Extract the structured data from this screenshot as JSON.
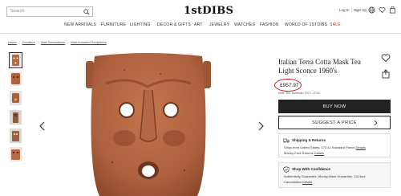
{
  "search": {
    "placeholder": "Search"
  },
  "logo": {
    "text": "1stDIBS"
  },
  "header": {
    "login": "Log In",
    "separator": "|",
    "signup": "Sign Up"
  },
  "nav": [
    {
      "label": "NEW ARRIVALS"
    },
    {
      "label": "FURNITURE"
    },
    {
      "label": "LIGHTING"
    },
    {
      "label": "DECOR & GIFTS"
    },
    {
      "label": "ART"
    },
    {
      "label": "JEWELRY"
    },
    {
      "label": "WATCHES"
    },
    {
      "label": "FASHION"
    },
    {
      "label": "WORLD OF 1STDIBS"
    },
    {
      "label": "SALE"
    }
  ],
  "breadcrumb": [
    "Home",
    "Furniture",
    "Wall Decorations",
    "Wall-mounted Sculptures"
  ],
  "product": {
    "title": "Italian Terra Cotta Mask Tea Light Sconce 1960's",
    "price": "£957.97",
    "estimate": "Note: Est. Estimate: £372 - £744"
  },
  "actions": {
    "buy": "BUY NOW",
    "suggest": "SUGGEST A PRICE"
  },
  "shipping": {
    "title": "Shipping & Returns",
    "line1_text": "Ships from United States: £73.42 Standard Parcel",
    "line1_link": "Details",
    "line2_text": "Money-Free Returns",
    "line2_link": "Details"
  },
  "confidence": {
    "title": "Shop With Confidence",
    "line1": "Authenticity Guarantee, Money-Back Guarantee, 24-Hour",
    "line2_text": "Cancellation",
    "line2_link": "Details"
  },
  "colors": {
    "accent": "#d01818",
    "terracotta": "#b56a4a",
    "dark": "#222222"
  }
}
